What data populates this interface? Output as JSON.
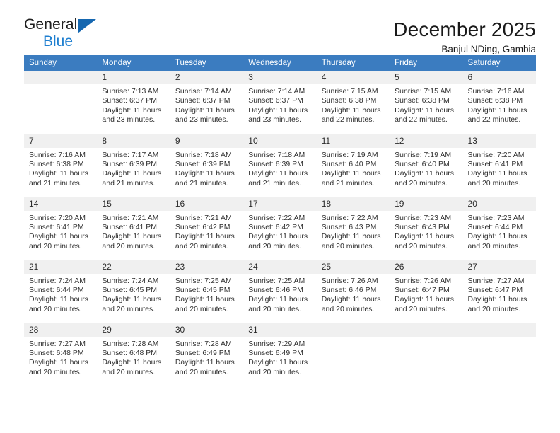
{
  "brand": {
    "name_top": "General",
    "name_bottom": "Blue",
    "triangle_icon": "triangle-icon",
    "accent_color": "#1f7fd0"
  },
  "header": {
    "title": "December 2025",
    "subtitle": "Banjul NDing, Gambia"
  },
  "theme": {
    "header_bg": "#3b7cc0",
    "daynum_bg": "#f0f0f0",
    "text": "#303030"
  },
  "weekday_headers": [
    "Sunday",
    "Monday",
    "Tuesday",
    "Wednesday",
    "Thursday",
    "Friday",
    "Saturday"
  ],
  "weeks": [
    [
      {
        "day": "",
        "sunrise": "",
        "sunset": "",
        "daylight": ""
      },
      {
        "day": "1",
        "sunrise": "Sunrise: 7:13 AM",
        "sunset": "Sunset: 6:37 PM",
        "daylight": "Daylight: 11 hours and 23 minutes."
      },
      {
        "day": "2",
        "sunrise": "Sunrise: 7:14 AM",
        "sunset": "Sunset: 6:37 PM",
        "daylight": "Daylight: 11 hours and 23 minutes."
      },
      {
        "day": "3",
        "sunrise": "Sunrise: 7:14 AM",
        "sunset": "Sunset: 6:37 PM",
        "daylight": "Daylight: 11 hours and 23 minutes."
      },
      {
        "day": "4",
        "sunrise": "Sunrise: 7:15 AM",
        "sunset": "Sunset: 6:38 PM",
        "daylight": "Daylight: 11 hours and 22 minutes."
      },
      {
        "day": "5",
        "sunrise": "Sunrise: 7:15 AM",
        "sunset": "Sunset: 6:38 PM",
        "daylight": "Daylight: 11 hours and 22 minutes."
      },
      {
        "day": "6",
        "sunrise": "Sunrise: 7:16 AM",
        "sunset": "Sunset: 6:38 PM",
        "daylight": "Daylight: 11 hours and 22 minutes."
      }
    ],
    [
      {
        "day": "7",
        "sunrise": "Sunrise: 7:16 AM",
        "sunset": "Sunset: 6:38 PM",
        "daylight": "Daylight: 11 hours and 21 minutes."
      },
      {
        "day": "8",
        "sunrise": "Sunrise: 7:17 AM",
        "sunset": "Sunset: 6:39 PM",
        "daylight": "Daylight: 11 hours and 21 minutes."
      },
      {
        "day": "9",
        "sunrise": "Sunrise: 7:18 AM",
        "sunset": "Sunset: 6:39 PM",
        "daylight": "Daylight: 11 hours and 21 minutes."
      },
      {
        "day": "10",
        "sunrise": "Sunrise: 7:18 AM",
        "sunset": "Sunset: 6:39 PM",
        "daylight": "Daylight: 11 hours and 21 minutes."
      },
      {
        "day": "11",
        "sunrise": "Sunrise: 7:19 AM",
        "sunset": "Sunset: 6:40 PM",
        "daylight": "Daylight: 11 hours and 21 minutes."
      },
      {
        "day": "12",
        "sunrise": "Sunrise: 7:19 AM",
        "sunset": "Sunset: 6:40 PM",
        "daylight": "Daylight: 11 hours and 20 minutes."
      },
      {
        "day": "13",
        "sunrise": "Sunrise: 7:20 AM",
        "sunset": "Sunset: 6:41 PM",
        "daylight": "Daylight: 11 hours and 20 minutes."
      }
    ],
    [
      {
        "day": "14",
        "sunrise": "Sunrise: 7:20 AM",
        "sunset": "Sunset: 6:41 PM",
        "daylight": "Daylight: 11 hours and 20 minutes."
      },
      {
        "day": "15",
        "sunrise": "Sunrise: 7:21 AM",
        "sunset": "Sunset: 6:41 PM",
        "daylight": "Daylight: 11 hours and 20 minutes."
      },
      {
        "day": "16",
        "sunrise": "Sunrise: 7:21 AM",
        "sunset": "Sunset: 6:42 PM",
        "daylight": "Daylight: 11 hours and 20 minutes."
      },
      {
        "day": "17",
        "sunrise": "Sunrise: 7:22 AM",
        "sunset": "Sunset: 6:42 PM",
        "daylight": "Daylight: 11 hours and 20 minutes."
      },
      {
        "day": "18",
        "sunrise": "Sunrise: 7:22 AM",
        "sunset": "Sunset: 6:43 PM",
        "daylight": "Daylight: 11 hours and 20 minutes."
      },
      {
        "day": "19",
        "sunrise": "Sunrise: 7:23 AM",
        "sunset": "Sunset: 6:43 PM",
        "daylight": "Daylight: 11 hours and 20 minutes."
      },
      {
        "day": "20",
        "sunrise": "Sunrise: 7:23 AM",
        "sunset": "Sunset: 6:44 PM",
        "daylight": "Daylight: 11 hours and 20 minutes."
      }
    ],
    [
      {
        "day": "21",
        "sunrise": "Sunrise: 7:24 AM",
        "sunset": "Sunset: 6:44 PM",
        "daylight": "Daylight: 11 hours and 20 minutes."
      },
      {
        "day": "22",
        "sunrise": "Sunrise: 7:24 AM",
        "sunset": "Sunset: 6:45 PM",
        "daylight": "Daylight: 11 hours and 20 minutes."
      },
      {
        "day": "23",
        "sunrise": "Sunrise: 7:25 AM",
        "sunset": "Sunset: 6:45 PM",
        "daylight": "Daylight: 11 hours and 20 minutes."
      },
      {
        "day": "24",
        "sunrise": "Sunrise: 7:25 AM",
        "sunset": "Sunset: 6:46 PM",
        "daylight": "Daylight: 11 hours and 20 minutes."
      },
      {
        "day": "25",
        "sunrise": "Sunrise: 7:26 AM",
        "sunset": "Sunset: 6:46 PM",
        "daylight": "Daylight: 11 hours and 20 minutes."
      },
      {
        "day": "26",
        "sunrise": "Sunrise: 7:26 AM",
        "sunset": "Sunset: 6:47 PM",
        "daylight": "Daylight: 11 hours and 20 minutes."
      },
      {
        "day": "27",
        "sunrise": "Sunrise: 7:27 AM",
        "sunset": "Sunset: 6:47 PM",
        "daylight": "Daylight: 11 hours and 20 minutes."
      }
    ],
    [
      {
        "day": "28",
        "sunrise": "Sunrise: 7:27 AM",
        "sunset": "Sunset: 6:48 PM",
        "daylight": "Daylight: 11 hours and 20 minutes."
      },
      {
        "day": "29",
        "sunrise": "Sunrise: 7:28 AM",
        "sunset": "Sunset: 6:48 PM",
        "daylight": "Daylight: 11 hours and 20 minutes."
      },
      {
        "day": "30",
        "sunrise": "Sunrise: 7:28 AM",
        "sunset": "Sunset: 6:49 PM",
        "daylight": "Daylight: 11 hours and 20 minutes."
      },
      {
        "day": "31",
        "sunrise": "Sunrise: 7:29 AM",
        "sunset": "Sunset: 6:49 PM",
        "daylight": "Daylight: 11 hours and 20 minutes."
      },
      {
        "day": "",
        "sunrise": "",
        "sunset": "",
        "daylight": ""
      },
      {
        "day": "",
        "sunrise": "",
        "sunset": "",
        "daylight": ""
      },
      {
        "day": "",
        "sunrise": "",
        "sunset": "",
        "daylight": ""
      }
    ]
  ]
}
